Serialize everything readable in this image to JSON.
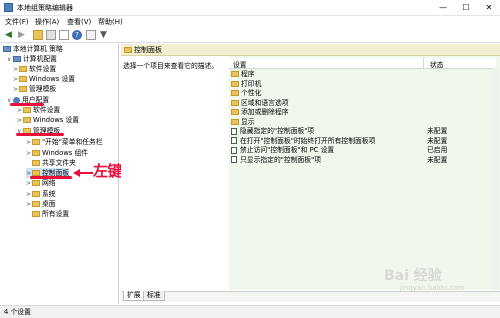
{
  "window": {
    "title": "本地组策略编辑器",
    "minimize": "—",
    "maximize": "☐",
    "close": "✕"
  },
  "menu": {
    "items": [
      "文件(F)",
      "操作(A)",
      "查看(V)",
      "帮助(H)"
    ]
  },
  "tree": {
    "root": "本地计算机 策略",
    "computer_config": "计算机配置",
    "software_settings": "软件设置",
    "windows_settings": "Windows 设置",
    "admin_templates": "管理模板",
    "user_config": "用户配置",
    "u_software_settings": "软件设置",
    "u_windows_settings": "Windows 设置",
    "u_admin_templates": "管理模板",
    "start_menu": "\"开始\"菜单和任务栏",
    "windows_components": "Windows 组件",
    "shared_folders": "共享文件夹",
    "control_panel": "控制面板",
    "network": "网络",
    "system": "系统",
    "desktop": "桌面",
    "all_settings": "所有设置"
  },
  "main": {
    "header": "控制面板",
    "description": "选择一个项目来查看它的描述。",
    "columns": {
      "setting": "设置",
      "state": "状态"
    },
    "rows": [
      {
        "name": "程序",
        "state": "",
        "type": "folder"
      },
      {
        "name": "打印机",
        "state": "",
        "type": "folder"
      },
      {
        "name": "个性化",
        "state": "",
        "type": "folder"
      },
      {
        "name": "区域和语言选项",
        "state": "",
        "type": "folder"
      },
      {
        "name": "添加或删除程序",
        "state": "",
        "type": "folder"
      },
      {
        "name": "显示",
        "state": "",
        "type": "folder"
      },
      {
        "name": "隐藏指定的\"控制面板\"项",
        "state": "未配置",
        "type": "policy"
      },
      {
        "name": "在打开\"控制面板\"时始终打开所有控制面板项",
        "state": "未配置",
        "type": "policy"
      },
      {
        "name": "禁止访问\"控制面板\"和 PC 设置",
        "state": "已启用",
        "type": "policy"
      },
      {
        "name": "只显示指定的\"控制面板\"项",
        "state": "未配置",
        "type": "policy"
      }
    ]
  },
  "tabs": [
    "扩展",
    "标准"
  ],
  "status": {
    "text": "4 个设置"
  },
  "annotation": {
    "text": "左键单击",
    "arrow": "←"
  },
  "watermark": {
    "text": "Bai 经验",
    "url": "jingyan.baidu.com"
  },
  "colors": {
    "annotation": "#e8103a",
    "header_bg": "#f3efd0",
    "list_bg": "#f0f8ee"
  }
}
